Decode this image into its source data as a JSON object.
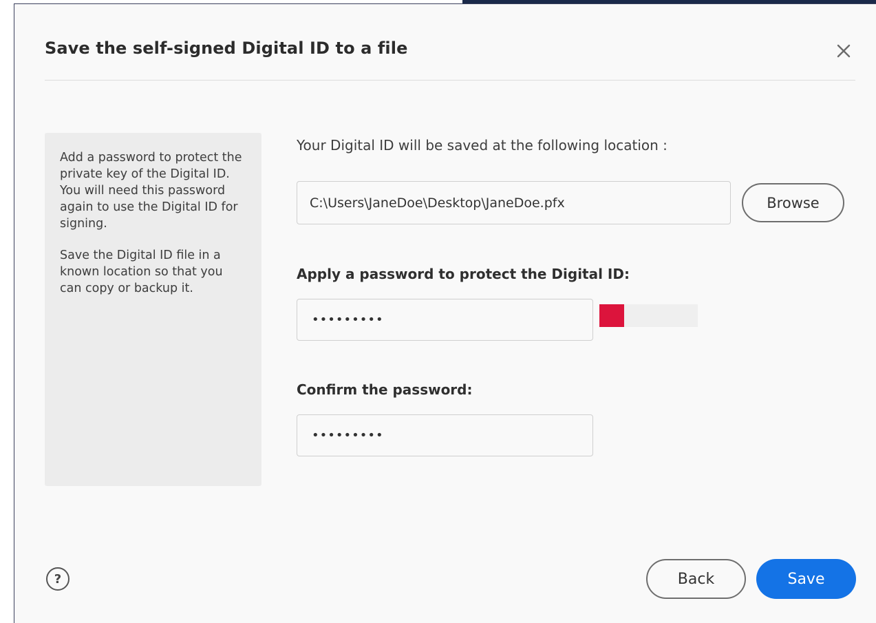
{
  "dialog": {
    "title": "Save the self-signed Digital ID to a file",
    "close_icon": "close-icon"
  },
  "info_panel": {
    "paragraph_1": "Add a password to protect the private key of the Digital ID. You will need this password again to use the Digital ID for signing.",
    "paragraph_2": "Save the Digital ID file in a known location so that you can copy or backup it."
  },
  "location": {
    "label": "Your Digital ID will be saved at the following location :",
    "path": "C:\\Users\\JaneDoe\\Desktop\\JaneDoe.pfx",
    "browse_label": "Browse"
  },
  "password": {
    "label": "Apply a password to protect the Digital ID:",
    "value": "•••••••••",
    "strength_fraction": 0.25,
    "strength_color": "#dc143c"
  },
  "confirm": {
    "label": "Confirm the password:",
    "value": "•••••••••"
  },
  "footer": {
    "help_glyph": "?",
    "back_label": "Back",
    "save_label": "Save"
  },
  "colors": {
    "accent": "#1473e6",
    "header_strip": "#1b2a4a"
  }
}
